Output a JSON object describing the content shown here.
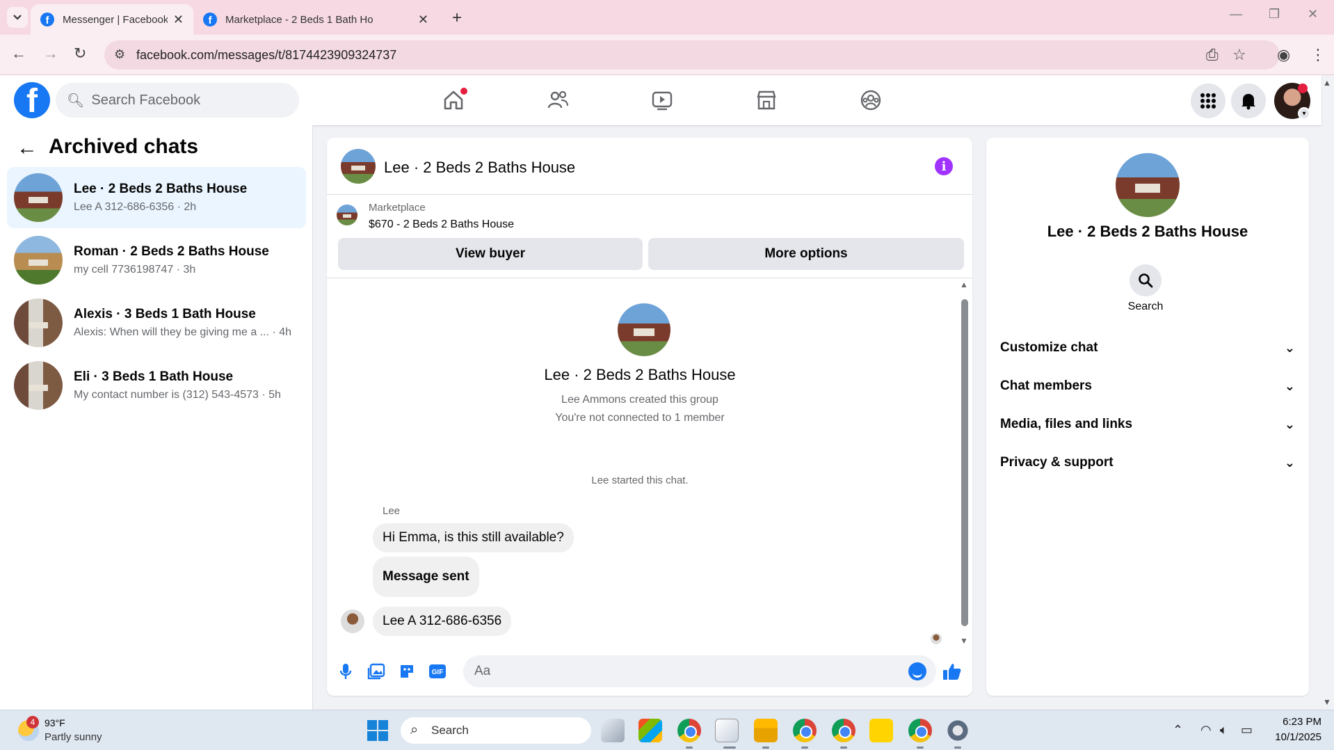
{
  "browser": {
    "tabs": [
      {
        "title": "Messenger | Facebook",
        "active": true
      },
      {
        "title": "Marketplace - 2 Beds 1 Bath Ho",
        "active": false
      }
    ],
    "url": "facebook.com/messages/t/8174423909324737"
  },
  "fb_header": {
    "search_placeholder": "Search Facebook"
  },
  "sidebar": {
    "title": "Archived chats",
    "chats": [
      {
        "name": "Lee · 2 Beds 2 Baths House",
        "preview": "Lee A 312-686-6356 · 2h",
        "active": true
      },
      {
        "name": "Roman · 2 Beds 2 Baths House",
        "preview": "my cell 7736198747 · 3h",
        "active": false
      },
      {
        "name": "Alexis · 3 Beds 1 Bath House",
        "preview": "Alexis: When will they be giving me a ... · 4h",
        "active": false
      },
      {
        "name": "Eli · 3 Beds 1 Bath House",
        "preview": "My contact number is (312) 543-4573 · 5h",
        "active": false
      }
    ]
  },
  "chat": {
    "title": "Lee · 2 Beds 2 Baths House",
    "marketplace": {
      "label": "Marketplace",
      "listing": "$670 - 2 Beds 2 Baths House",
      "view_buyer": "View buyer",
      "more_options": "More options"
    },
    "group_name": "Lee · 2 Beds 2 Baths House",
    "created_by": "Lee Ammons created this group",
    "connection": "You're not connected to 1 member",
    "system_msg": "Lee started this chat.",
    "sender": "Lee",
    "messages": [
      {
        "text": "Hi Emma, is this still available?"
      },
      {
        "text": "Message sent"
      },
      {
        "text": "Lee A 312-686-6356"
      }
    ],
    "composer_placeholder": "Aa"
  },
  "info_panel": {
    "name": "Lee · 2 Beds 2 Baths House",
    "search_label": "Search",
    "sections": [
      "Customize chat",
      "Chat members",
      "Media, files and links",
      "Privacy & support"
    ]
  },
  "taskbar": {
    "weather_badge": "4",
    "temperature": "93°F",
    "weather": "Partly sunny",
    "search_label": "Search",
    "time": "6:23 PM",
    "date": "10/1/2025"
  },
  "colors": {
    "fb_blue": "#1877f2",
    "info_purple": "#a033ff",
    "active_chat_bg": "#ebf5ff"
  }
}
